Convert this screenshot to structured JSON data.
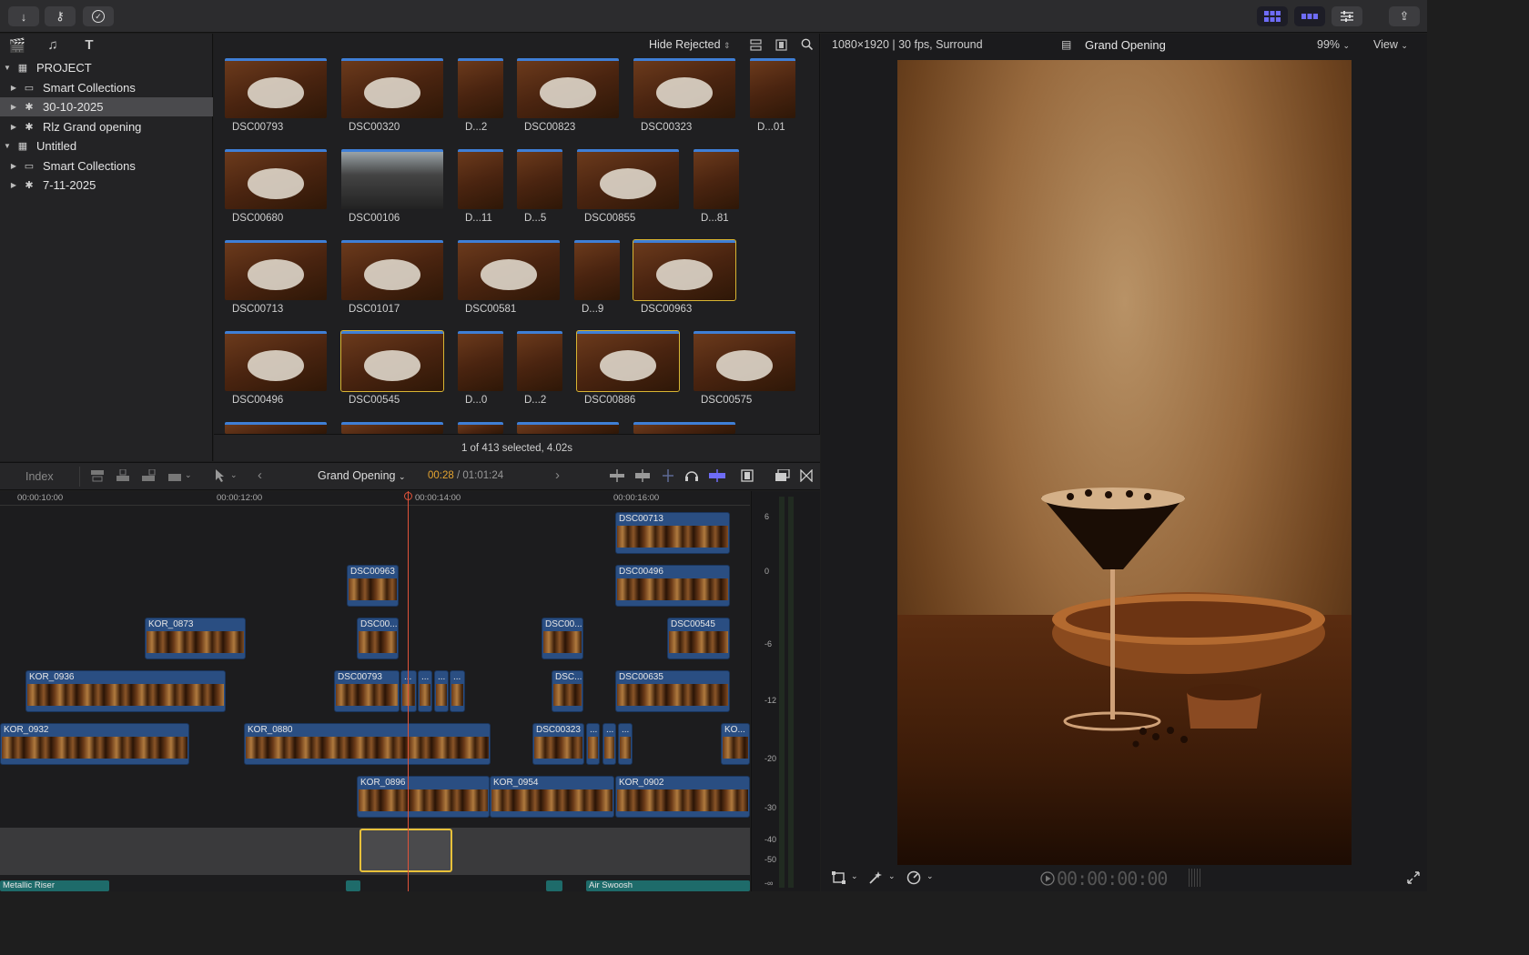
{
  "toolbar": {
    "import_icon": "↓",
    "keywords_icon": "⚷",
    "check_icon": "✓",
    "share_icon": "⇪"
  },
  "sidebar": {
    "items": [
      {
        "label": "PROJECT",
        "level": 0,
        "expanded": true,
        "icon": "grid-icon"
      },
      {
        "label": "Smart Collections",
        "level": 1,
        "icon": "folder-icon"
      },
      {
        "label": "30-10-2025",
        "level": 1,
        "icon": "star-icon",
        "selected": true
      },
      {
        "label": "Rlz Grand opening",
        "level": 1,
        "icon": "star-icon"
      },
      {
        "label": "Untitled",
        "level": 0,
        "expanded": true,
        "icon": "grid-icon"
      },
      {
        "label": "Smart Collections",
        "level": 1,
        "icon": "folder-icon"
      },
      {
        "label": "7-11-2025",
        "level": 1,
        "icon": "star-icon"
      }
    ]
  },
  "browser": {
    "filter": "Hide Rejected",
    "status": "1 of 413 selected, 4.02s",
    "clips": [
      "DSC00793",
      "DSC00320",
      "D...2",
      "DSC00823",
      "DSC00323",
      "D...01",
      "DSC00680",
      "DSC00106",
      "D...11",
      "D...5",
      "DSC00855",
      "D...81",
      "DSC00713",
      "DSC01017",
      "DSC00581",
      "D...9",
      "DSC00963",
      "DSC00496",
      "DSC00545",
      "D...0",
      "D...2",
      "DSC00886",
      "DSC00575"
    ]
  },
  "viewer": {
    "format": "1080×1920 | 30 fps, Surround",
    "title": "Grand Opening",
    "zoom": "99%",
    "view": "View",
    "timecode": "00:00:00:00"
  },
  "timeline": {
    "index": "Index",
    "project": "Grand Opening",
    "position": "00:28",
    "duration": "/ 01:01:24",
    "ruler": [
      "00:00:10:00",
      "00:00:12:00",
      "00:00:14:00",
      "00:00:16:00"
    ],
    "clips": [
      "DSC00713",
      "DSC00963",
      "DSC00496",
      "KOR_0873",
      "DSC00...",
      "DSC00...",
      "DSC00545",
      "KOR_0936",
      "DSC00793",
      "DSC...",
      "DSC00635",
      "KOR_0932",
      "KOR_0880",
      "DSC00323",
      "KO...",
      "KOR_0896",
      "KOR_0954",
      "KOR_0902"
    ],
    "audio": [
      "Metallic Riser",
      "Air Swoosh"
    ],
    "meter": [
      "6",
      "0",
      "-6",
      "-12",
      "-20",
      "-30",
      "-40",
      "-50",
      "-∞"
    ]
  }
}
